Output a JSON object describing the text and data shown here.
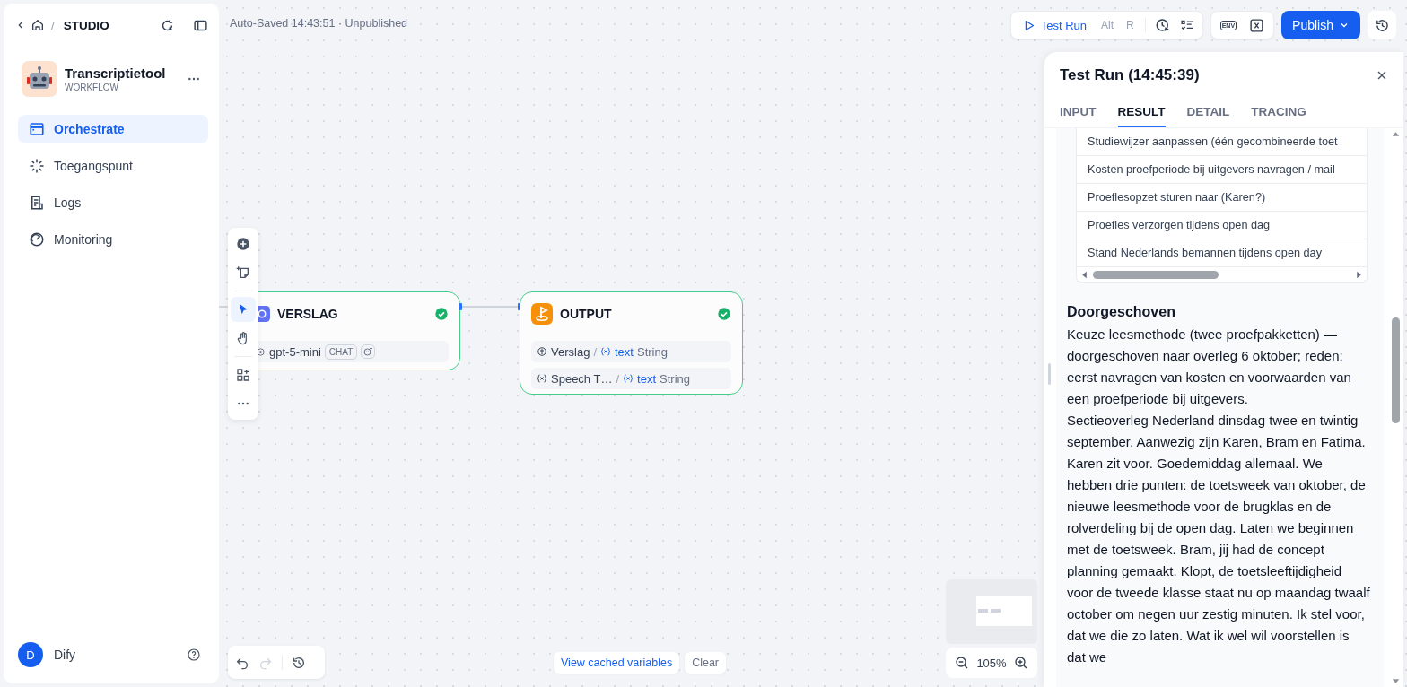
{
  "header": {
    "separator": "/",
    "section": "STUDIO",
    "autosave": "Auto-Saved 14:43:51 · Unpublished"
  },
  "app": {
    "name": "Transcriptietool",
    "type": "WORKFLOW"
  },
  "sidebar": {
    "items": [
      {
        "kind": "orchestrate",
        "label": "Orchestrate",
        "selected": true
      },
      {
        "kind": "access",
        "label": "Toegangspunt",
        "selected": false
      },
      {
        "kind": "logs",
        "label": "Logs",
        "selected": false
      },
      {
        "kind": "monitoring",
        "label": "Monitoring",
        "selected": false
      }
    ]
  },
  "user": {
    "initial": "D",
    "name": "Dify"
  },
  "toolbar": {
    "test_run": "Test Run",
    "keys": [
      "Alt",
      "R"
    ],
    "env": "ENV",
    "publish": "Publish"
  },
  "tools": [
    {
      "kind": "add",
      "selected": false
    },
    {
      "kind": "note",
      "selected": false
    },
    {
      "kind": "pointer",
      "selected": true
    },
    {
      "kind": "hand",
      "selected": false
    },
    {
      "kind": "organize",
      "selected": false
    },
    {
      "kind": "more",
      "selected": false
    }
  ],
  "nodes": [
    {
      "kind": "llm",
      "title": "VERSLAG",
      "succeeded": true,
      "model": "gpt-5-mini",
      "mode": "CHAT"
    },
    {
      "kind": "end",
      "title": "OUTPUT",
      "succeeded": true,
      "outputs": [
        {
          "kind": "node",
          "source": "Verslag",
          "separator": "/",
          "variable": "text",
          "type": "String"
        },
        {
          "kind": "variable",
          "source": "Speech T…",
          "separator": "/",
          "variable": "text",
          "type": "String"
        }
      ]
    }
  ],
  "history": [
    {
      "kind": "undo",
      "disabled": false
    },
    {
      "kind": "redo",
      "disabled": true
    },
    {
      "kind": "history",
      "disabled": false
    }
  ],
  "cache": {
    "view": "View cached variables",
    "clear": "Clear"
  },
  "zoom": "105%",
  "panel": {
    "title": "Test Run (14:45:39)",
    "tabs": [
      {
        "label": "INPUT",
        "selected": false
      },
      {
        "label": "RESULT",
        "selected": true
      },
      {
        "label": "DETAIL",
        "selected": false
      },
      {
        "label": "TRACING",
        "selected": false
      }
    ],
    "rows": [
      "Studiewijzer aanpassen (één gecombineerde toet",
      "Kosten proefperiode bij uitgevers navragen / mail",
      "Proeflesopzet sturen naar (Karen?)",
      "Proefles verzorgen tijdens open dag",
      "Stand Nederlands bemannen tijdens open day"
    ],
    "heading": "Doorgeschoven",
    "paragraphs": [
      "Keuze leesmethode (twee proefpakketten) — doorgeschoven naar overleg 6 oktober; reden: eerst navragen van kosten en voorwaarden van een proefperiode bij uitgevers.",
      "Sectieoverleg Nederland dinsdag twee en twintig september. Aanwezig zijn Karen, Bram en Fatima. Karen zit voor. Goedemiddag allemaal. We hebben drie punten: de toetsweek van oktober, de nieuwe leesmethode voor de brugklas en de rolverdeling bij de open dag. Laten we beginnen met de toetsweek. Bram, jij had de concept planning gemaakt. Klopt, de toetsleeftijdigheid voor de tweede klasse staat nu op maandag twaalf october om negen uur zestig minuten. Ik stel voor, dat we die zo laten. Wat ik wel wil voorstellen is dat we"
    ]
  }
}
